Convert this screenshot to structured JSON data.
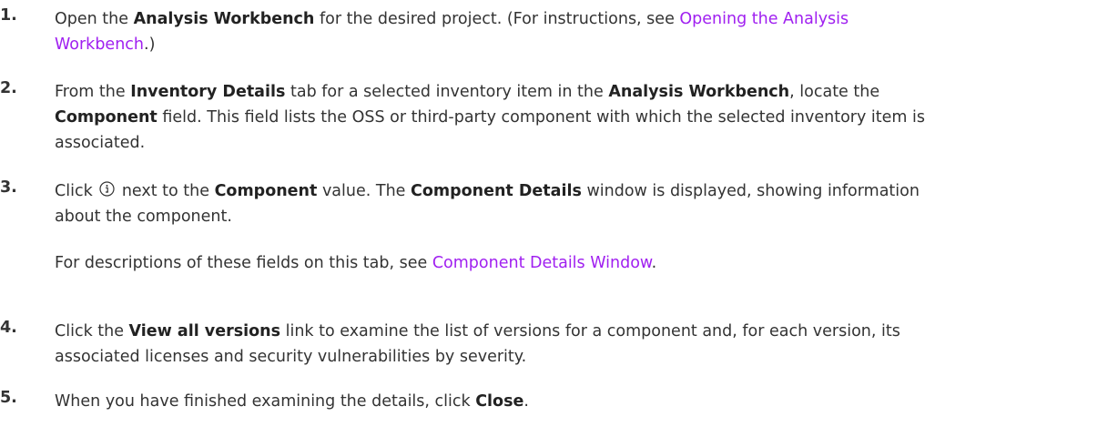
{
  "steps": [
    {
      "number": "1.",
      "line1": {
        "t1": "Open the ",
        "b1": "Analysis Workbench",
        "t2": " for the desired project. (For instructions, see ",
        "link1": "Opening the Analysis"
      },
      "line2": {
        "link2": "Workbench",
        "t3": ".)"
      }
    },
    {
      "number": "2.",
      "line1": {
        "t1": "From the ",
        "b1": "Inventory Details",
        "t2": " tab for a selected inventory item in the ",
        "b2": "Analysis Workbench",
        "t3": ", locate the"
      },
      "line2": {
        "b1": "Component",
        "t1": " field. This field lists the OSS or third-party component with which the selected inventory item is"
      },
      "line3": {
        "t1": "associated."
      }
    },
    {
      "number": "3.",
      "line1": {
        "t1": "Click ",
        "icon": "info-circle-icon",
        "t2": " next to the ",
        "b1": "Component",
        "t3": " value. The ",
        "b2": "Component Details",
        "t4": " window is displayed, showing information"
      },
      "line2": {
        "t1": "about the component."
      },
      "note": {
        "t1": "For descriptions of these fields on this tab, see ",
        "link": "Component Details Window",
        "t2": "."
      }
    },
    {
      "number": "4.",
      "line1": {
        "t1": "Click the ",
        "b1": "View all versions",
        "t2": " link to examine the list of versions for a component and, for each version, its"
      },
      "line2": {
        "t1": "associated licenses and security vulnerabilities by severity."
      }
    },
    {
      "number": "5.",
      "line1": {
        "t1": "When you have finished examining the details, click ",
        "b1": "Close",
        "t2": "."
      }
    }
  ],
  "colors": {
    "text": "#333333",
    "link": "#a020f0"
  }
}
